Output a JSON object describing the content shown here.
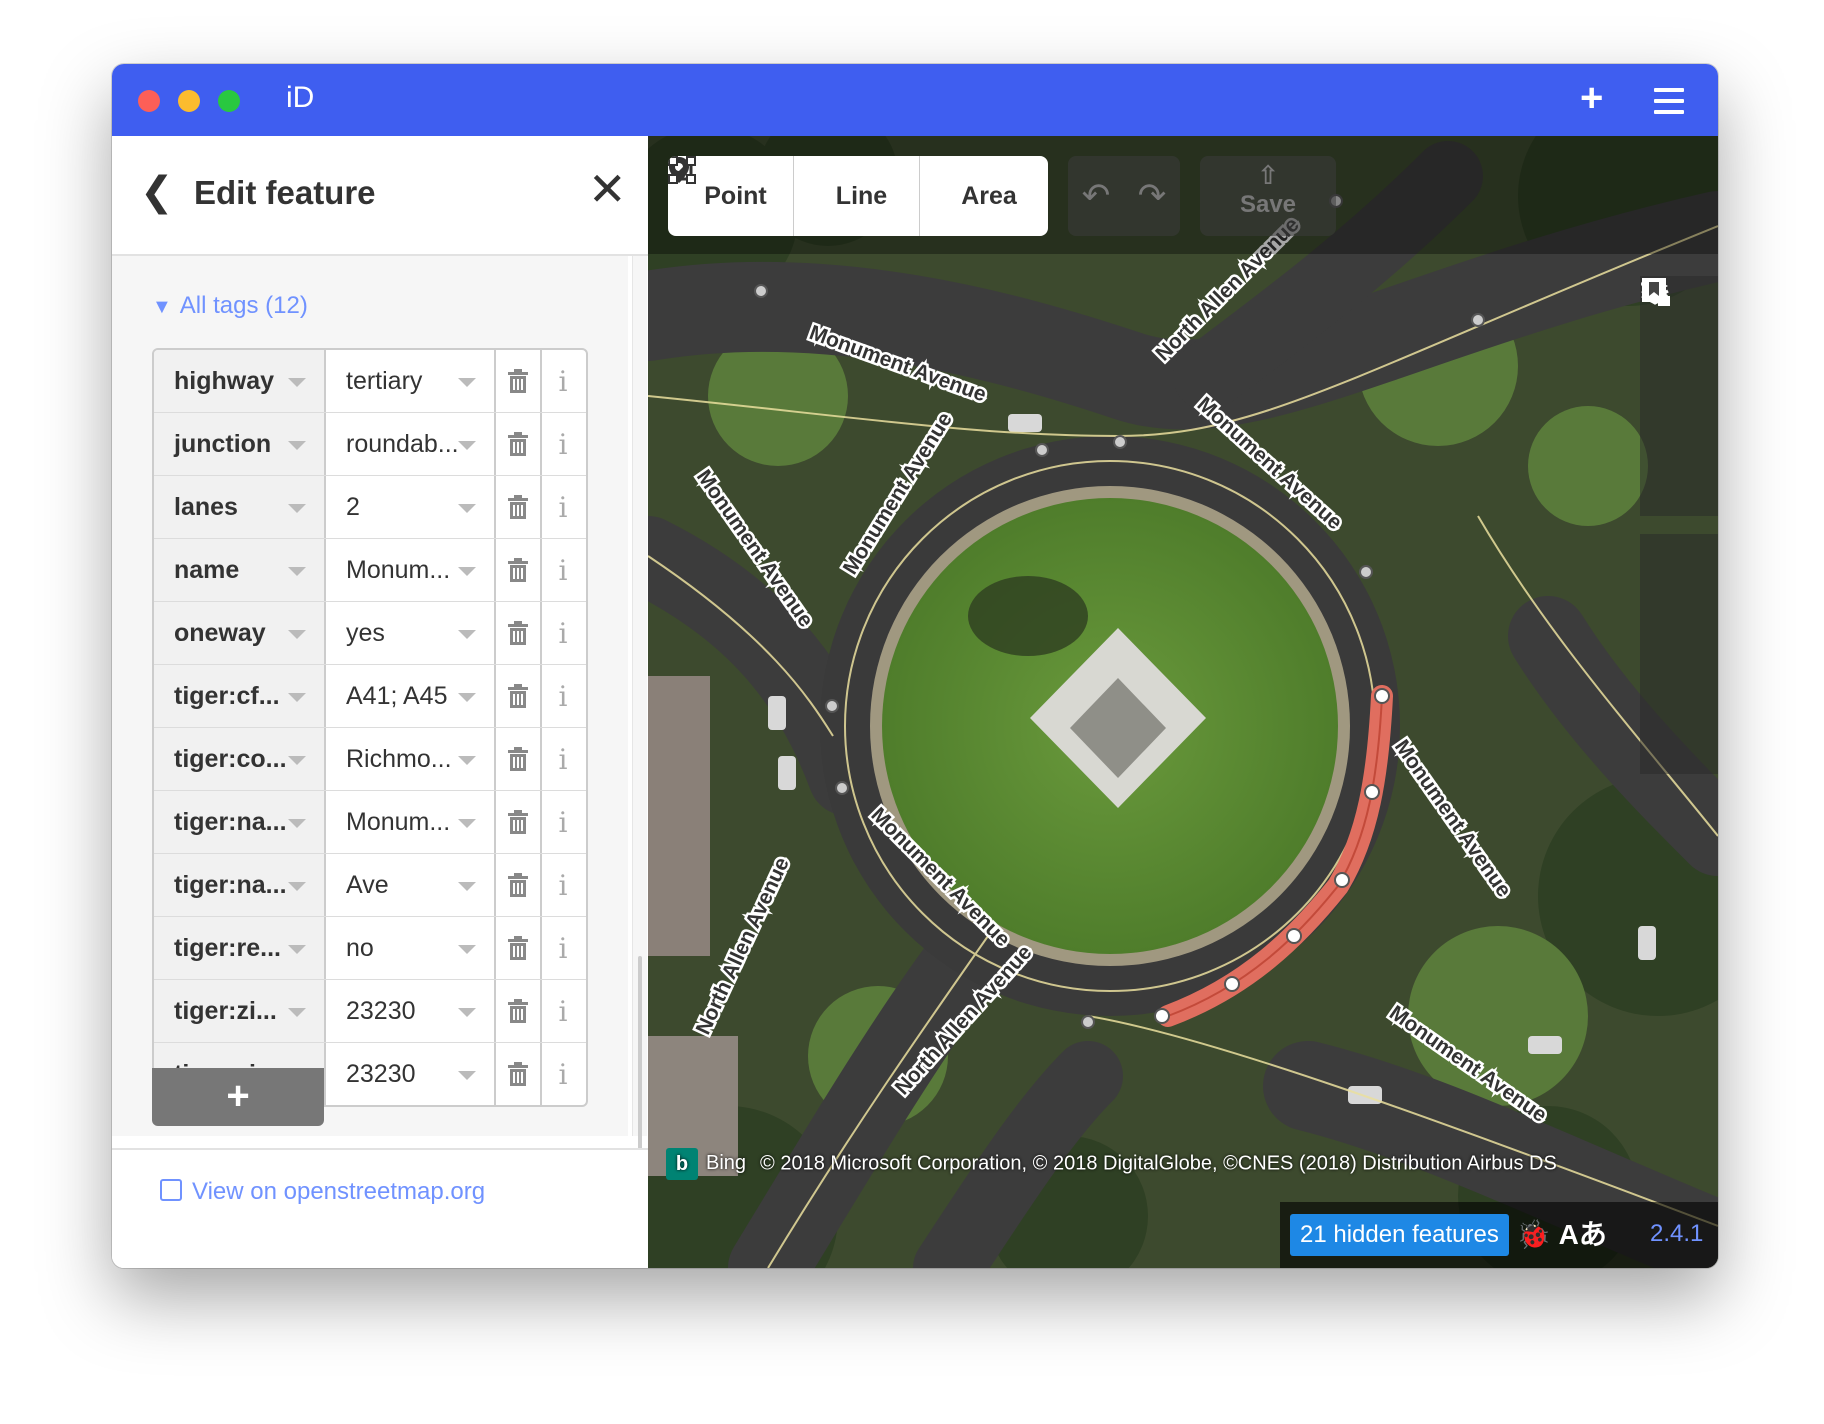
{
  "app": {
    "title": "iD",
    "add_icon": "plus-icon",
    "menu_icon": "hamburger-icon"
  },
  "sidebar": {
    "header_title": "Edit feature",
    "tags_toggle": "All tags (12)",
    "tags": [
      {
        "key": "highway",
        "value": "tertiary"
      },
      {
        "key": "junction",
        "value": "roundab..."
      },
      {
        "key": "lanes",
        "value": "2"
      },
      {
        "key": "name",
        "value": "Monum..."
      },
      {
        "key": "oneway",
        "value": "yes"
      },
      {
        "key": "tiger:cf...",
        "value": "A41; A45"
      },
      {
        "key": "tiger:co...",
        "value": "Richmo..."
      },
      {
        "key": "tiger:na...",
        "value": "Monum..."
      },
      {
        "key": "tiger:na...",
        "value": "Ave"
      },
      {
        "key": "tiger:re...",
        "value": "no"
      },
      {
        "key": "tiger:zi...",
        "value": "23230"
      },
      {
        "key": "tiger:zi...",
        "value": "23230"
      }
    ],
    "add_tag_label": "+",
    "view_on_osm": "View on openstreetmap.org"
  },
  "toolbar": {
    "point_label": "Point",
    "line_label": "Line",
    "area_label": "Area",
    "save_label": "Save"
  },
  "map": {
    "road_labels": {
      "monument": "Monument Avenue",
      "north_allen": "North Allen Avenue"
    },
    "attribution_provider": "Bing",
    "attribution": "© 2018 Microsoft Corporation, © 2018 DigitalGlobe, ©CNES (2018) Distribution Airbus DS",
    "hidden_features": "21 hidden features",
    "issues_label": "Aあ",
    "version": "2.4.1",
    "selected_color": "#e06e5f",
    "accent_color": "#3f5ef0"
  }
}
